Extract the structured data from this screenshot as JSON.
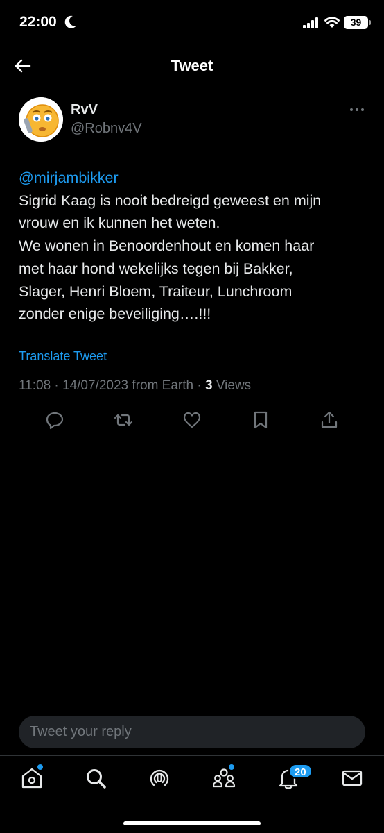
{
  "status_bar": {
    "time": "22:00",
    "battery": "39"
  },
  "header": {
    "title": "Tweet"
  },
  "tweet": {
    "author_name": "RvV",
    "author_handle": "@Robnv4V",
    "mention": "@mirjambikker",
    "lines": [
      "Sigrid Kaag is nooit bedreigd geweest en mijn",
      "vrouw en ik kunnen het weten.",
      "We wonen in Benoordenhout en komen haar",
      "met haar hond wekelijks tegen bij Bakker,",
      "Slager, Henri Bloem, Traiteur, Lunchroom",
      "zonder enige beveiliging….!!!"
    ],
    "translate_label": "Translate Tweet",
    "timestamp": "11:08 · 14/07/2023 from Earth · ",
    "views_count": "3",
    "views_label": " Views"
  },
  "actions": [
    {
      "icon": "reply-icon"
    },
    {
      "icon": "retweet-icon"
    },
    {
      "icon": "like-icon"
    },
    {
      "icon": "bookmark-icon"
    },
    {
      "icon": "share-icon"
    }
  ],
  "reply": {
    "placeholder": "Tweet your reply"
  },
  "nav": {
    "items": [
      {
        "icon": "home-icon",
        "has_dot": true
      },
      {
        "icon": "search-icon",
        "has_dot": false
      },
      {
        "icon": "spaces-icon",
        "has_dot": false
      },
      {
        "icon": "communities-icon",
        "has_dot": true
      },
      {
        "icon": "notifications-icon",
        "has_dot": false
      },
      {
        "icon": "messages-icon",
        "has_dot": false
      }
    ],
    "notifications_badge": "20"
  },
  "colors": {
    "background": "#000000",
    "accent": "#1d9bf0",
    "text_primary": "#e7e9ea",
    "text_secondary": "#71767b"
  }
}
